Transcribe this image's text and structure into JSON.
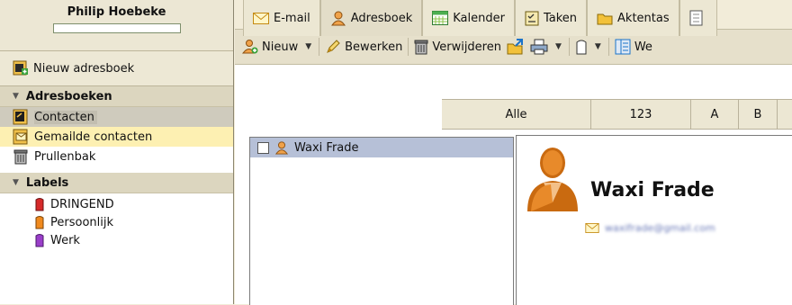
{
  "user": {
    "name": "Philip Hoebeke"
  },
  "sidebar": {
    "new_addressbook": "Nieuw adresboek",
    "addressbooks_header": "Adresboeken",
    "addressbooks": [
      {
        "label": "Contacten",
        "icon": "contacts-book-icon",
        "state": "selected"
      },
      {
        "label": "Gemailde contacten",
        "icon": "mailed-contacts-icon",
        "state": "hover"
      },
      {
        "label": "Prullenbak",
        "icon": "trash-icon",
        "state": ""
      }
    ],
    "labels_header": "Labels",
    "labels": [
      {
        "label": "DRINGEND",
        "color": "#d62a2a"
      },
      {
        "label": "Persoonlijk",
        "color": "#f08a1e"
      },
      {
        "label": "Werk",
        "color": "#9a3fc9"
      }
    ]
  },
  "tabs": [
    {
      "label": "E-mail",
      "icon": "envelope-icon"
    },
    {
      "label": "Adresboek",
      "icon": "person-icon",
      "active": true
    },
    {
      "label": "Kalender",
      "icon": "calendar-icon"
    },
    {
      "label": "Taken",
      "icon": "tasks-icon"
    },
    {
      "label": "Aktentas",
      "icon": "folder-icon"
    },
    {
      "label": "",
      "icon": "notes-icon"
    }
  ],
  "toolbar": {
    "new": "Nieuw",
    "edit": "Bewerken",
    "delete": "Verwijderen",
    "more": "We"
  },
  "alphabet": [
    "Alle",
    "123",
    "A",
    "B",
    ""
  ],
  "contacts": [
    {
      "name": "Waxi Frade"
    }
  ],
  "detail": {
    "name": "Waxi Frade",
    "email": "waxifrade@gmail.com"
  }
}
